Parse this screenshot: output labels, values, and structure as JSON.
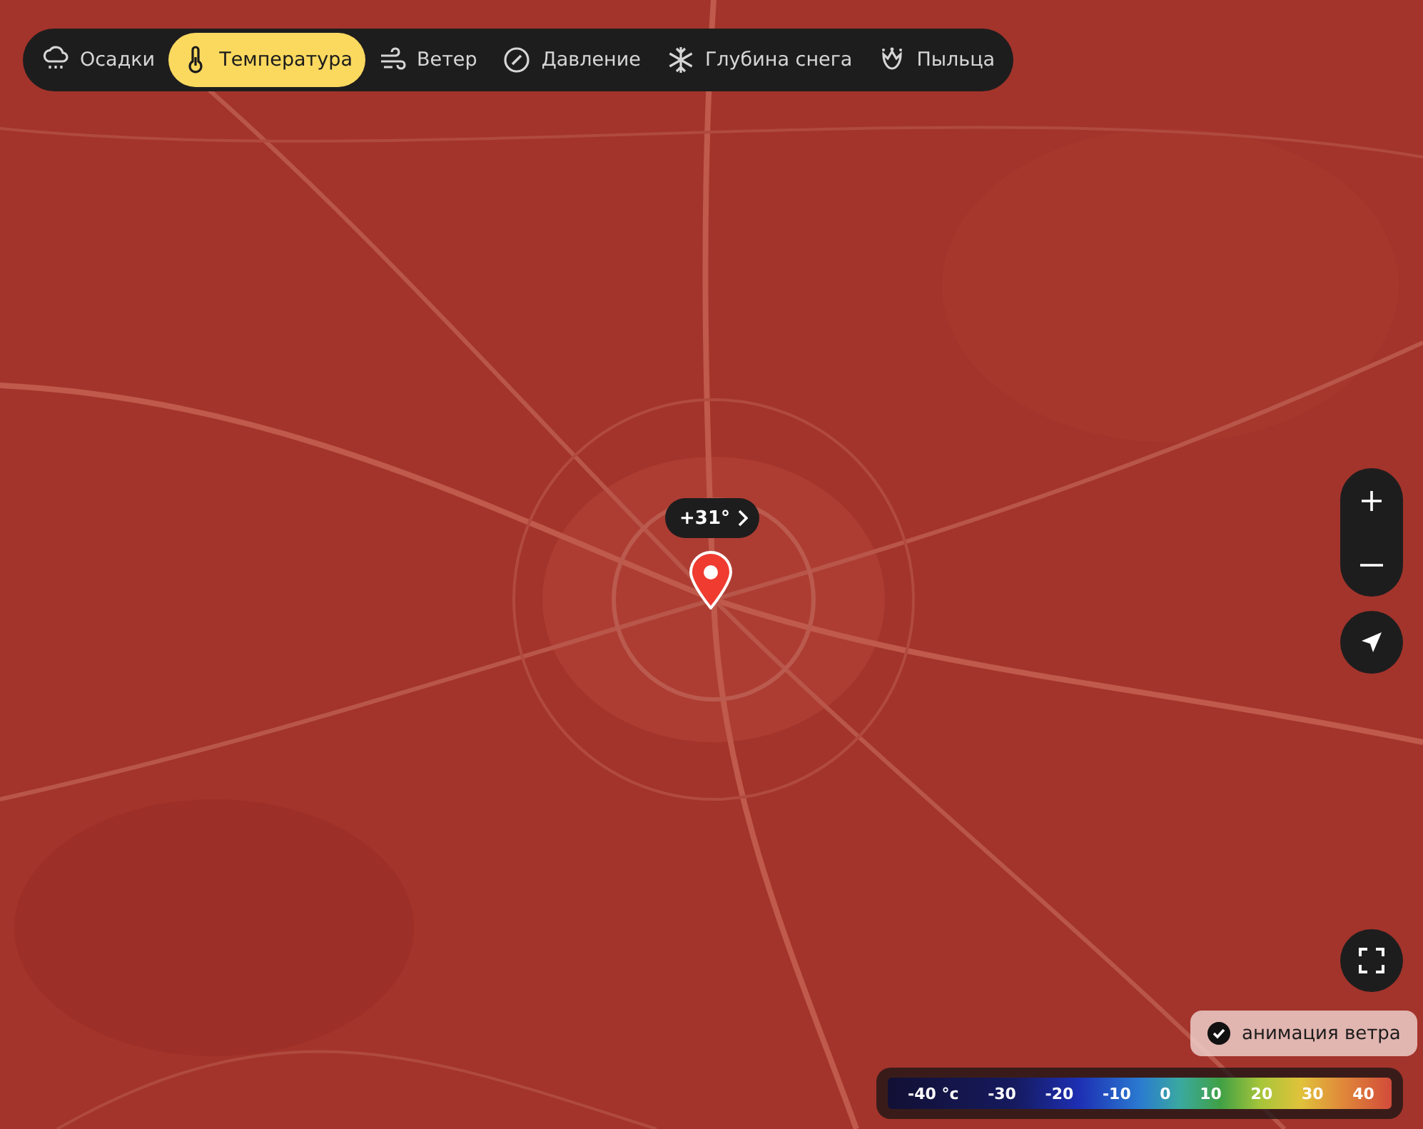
{
  "layers": [
    {
      "label": "Осадки",
      "kind": "cloud",
      "selected": false
    },
    {
      "label": "Температура",
      "kind": "thermometer",
      "selected": true
    },
    {
      "label": "Ветер",
      "kind": "wind",
      "selected": false
    },
    {
      "label": "Давление",
      "kind": "gauge",
      "selected": false
    },
    {
      "label": "Глубина снега",
      "kind": "snow",
      "selected": false
    },
    {
      "label": "Пыльца",
      "kind": "flower",
      "selected": false
    }
  ],
  "location_bubble": {
    "text": "+31°"
  },
  "wind_animation": {
    "label": "анимация ветра",
    "checked": true
  },
  "legend": {
    "labels": [
      "-40 °c",
      "-30",
      "-20",
      "-10",
      "0",
      "10",
      "20",
      "30",
      "40"
    ]
  }
}
